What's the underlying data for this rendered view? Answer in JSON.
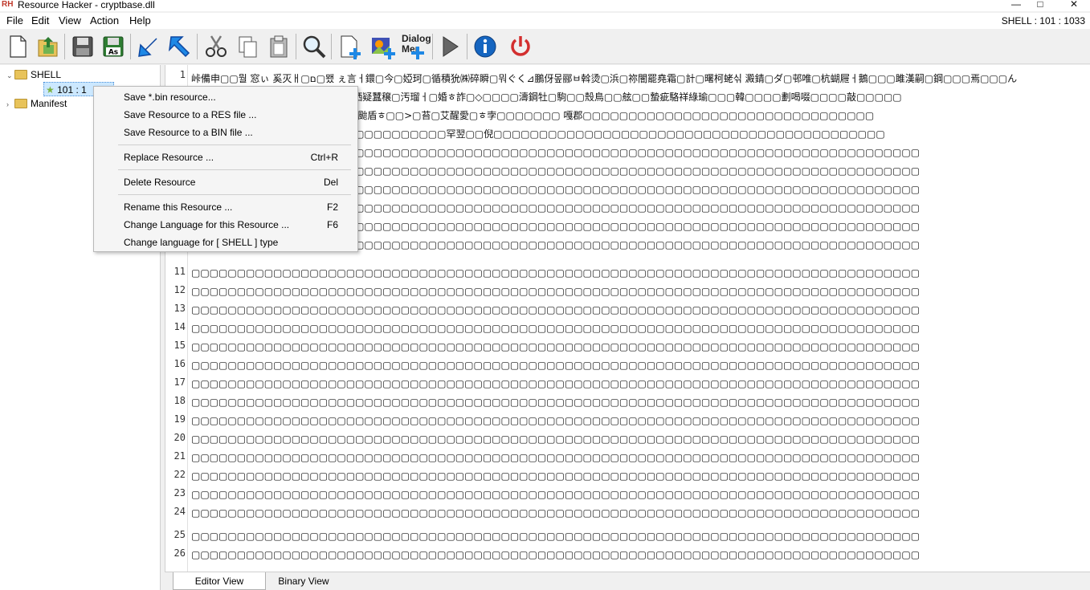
{
  "window": {
    "title": "Resource Hacker - cryptbase.dll",
    "logo_text": "RH",
    "minimize": "—",
    "maximize": "□",
    "close": "✕"
  },
  "status": {
    "resource_id": "SHELL : 101 : 1033"
  },
  "menu": [
    "File",
    "Edit",
    "View",
    "Action",
    "Help"
  ],
  "toolbar": {
    "dialog_label_1": "Dialog",
    "dialog_label_2": "Mer",
    "icons": [
      "new-file-icon",
      "open-icon",
      "save-icon",
      "save-as-icon",
      "arrow-back-icon",
      "arrow-forward-icon",
      "cut-icon",
      "copy-icon",
      "paste-icon",
      "find-icon",
      "add-resource-icon",
      "add-image-icon",
      "dialog-merger-icon",
      "play-icon",
      "info-icon",
      "power-icon"
    ],
    "save_as_badge": "As"
  },
  "tree": {
    "root": "SHELL",
    "child": "101 : 1",
    "manifest": "Manifest",
    "expander": "⌄",
    "collapser": "›"
  },
  "context_menu": [
    {
      "label": "Save *.bin resource...",
      "shortcut": ""
    },
    {
      "label": "Save Resource to a RES file ...",
      "shortcut": ""
    },
    {
      "label": "Save Resource to a BIN file ...",
      "shortcut": ""
    },
    {
      "label": "Replace Resource ...",
      "shortcut": "Ctrl+R"
    },
    {
      "label": "Delete Resource",
      "shortcut": "Del"
    },
    {
      "label": "Rename this Resource ...",
      "shortcut": "F2"
    },
    {
      "label": "Change Language for this Resource ...",
      "shortcut": "F6"
    },
    {
      "label": "Change language for [ SHELL ] type",
      "shortcut": ""
    }
  ],
  "editor": {
    "line_numbers": [
      "1",
      "2",
      "3",
      "4",
      "5",
      "6",
      "7",
      "8",
      "9",
      "10",
      "11",
      "12",
      "13",
      "14",
      "15",
      "16",
      "17",
      "18",
      "19",
      "20",
      "21",
      "22",
      "23",
      "24",
      "25",
      "26"
    ],
    "lines": [
      "峠備申▢▢뭘 窓ぃ 奚灭ㅐ▢ם▢뫴 ぇ言ㅓ鐶▢今▢婭珂▢循積狁㈱碎瞬▢뭐ぐく⊿鵬伢뫂郦ㅂ斡烫▢浜▢祢闇罷堯霜▢計▢曙柯蛯싞 澱錆▢ダ▢邨唯▢杭蝴屜ㅓ鵝▢▢▢雎漢嗣▢鋼▢▢▢焉▢▢▢ん",
      "▢▢▢▢鏨靴钳 ▢▢汽熡蝶愧▢▢▢▢洒疑蠶穣▢汚瑠ㅓ▢婚ㅎ詐▢◇▢▢▢▢濤鋼牡▢駒▢▢殼鳥▢▢舷▢▢蟄疵駱祥綠瑜▢▢▢韓▢▢▢▢劃喝啜▢▢▢▢敲▢▢▢▢▢",
      "▢▢▢▢▢▢▢▢▢▢▢▢鵬郎破萎柏▢颱盾ㅎ▢▢>▢苔▢艾醒愛▢ㅎ孛▢▢▢▢▢▢▢ 嘎郡▢▢▢▢▢▢▢▢▢▢▢▢▢▢▢▢▢▢▢▢▢▢▢▢▢▢▢▢▢▢▢▢",
      "▢▢▢▢▢▢▢▢▢▢▢▢▢▢▢▢▢▢▢▢▢▢▢▢▢▢▢▢罕翌▢▢倪▢▢▢▢▢▢▢▢▢▢▢▢▢▢▢▢▢▢▢▢▢▢▢▢▢▢▢▢▢▢▢▢▢▢▢▢▢▢▢▢▢▢▢",
      "▢▢▢▢▢▢▢▢▢▢▢▢▢▢▢▢▢▢▢▢▢▢▢▢▢▢▢▢▢▢▢▢▢▢▢▢▢▢▢▢▢▢▢▢▢▢▢▢▢▢▢▢▢▢▢▢▢▢▢▢▢▢▢▢▢▢▢▢▢▢▢▢▢▢▢▢▢▢▢▢",
      "▢▢▢▢▢▢▢▢▢▢▢▢▢▢▢▢▢▢▢▢▢▢▢▢▢▢▢▢▢▢▢▢▢▢▢▢▢▢▢▢▢▢▢▢▢▢▢▢▢▢▢▢▢▢▢▢▢▢▢▢▢▢▢▢▢▢▢▢▢▢▢▢▢▢▢▢▢▢▢▢",
      "▢▢▢▢▢▢▢▢▢▢▢▢▢▢▢▢▢▢▢▢▢▢▢▢▢▢▢▢▢▢▢▢▢▢▢▢▢▢▢▢▢▢▢▢▢▢▢▢▢▢▢▢▢▢▢▢▢▢▢▢▢▢▢▢▢▢▢▢▢▢▢▢▢▢▢▢▢▢▢▢",
      "▢▢▢▢▢▢▢▢▢▢▢▢▢▢▢▢▢▢▢▢▢▢▢▢▢▢▢▢▢▢▢▢▢▢▢▢▢▢▢▢▢▢▢▢▢▢▢▢▢▢▢▢▢▢▢▢▢▢▢▢▢▢▢▢▢▢▢▢▢▢▢▢▢▢▢▢▢▢▢▢",
      "▢▢▢▢▢▢▢▢▢▢▢▢▢▢▢▢▢▢▢▢▢▢▢▢▢▢▢▢▢▢▢▢▢▢▢▢▢▢▢▢▢▢▢▢▢▢▢▢▢▢▢▢▢▢▢▢▢▢▢▢▢▢▢▢▢▢▢▢▢▢▢▢▢▢▢▢▢▢▢▢",
      "▢▢▢▢▢▢▢▢▢▢▢▢▢▢▢▢▢▢▢▢▢▢▢▢▢▢▢▢▢▢▢▢▢▢▢▢▢▢▢▢▢▢▢▢▢▢▢▢▢▢▢▢▢▢▢▢▢▢▢▢▢▢▢▢▢▢▢▢▢▢▢▢▢▢▢▢▢▢▢▢",
      "▢▢▢▢▢▢▢▢▢▢▢▢▢▢▢▢▢▢▢▢▢▢▢▢▢▢▢▢▢▢▢▢▢▢▢▢▢▢▢▢▢▢▢▢▢▢▢▢▢▢▢▢▢▢▢▢▢▢▢▢▢▢▢▢▢▢▢▢▢▢▢▢▢▢▢▢▢▢▢▢",
      "▢▢▢▢▢▢▢▢▢▢▢▢▢▢▢▢▢▢▢▢▢▢▢▢▢▢▢▢▢▢▢▢▢▢▢▢▢▢▢▢▢▢▢▢▢▢▢▢▢▢▢▢▢▢▢▢▢▢▢▢▢▢▢▢▢▢▢▢▢▢▢▢▢▢▢▢▢▢▢▢",
      "▢▢▢▢▢▢▢▢▢▢▢▢▢▢▢▢▢▢▢▢▢▢▢▢▢▢▢▢▢▢▢▢▢▢▢▢▢▢▢▢▢▢▢▢▢▢▢▢▢▢▢▢▢▢▢▢▢▢▢▢▢▢▢▢▢▢▢▢▢▢▢▢▢▢▢▢▢▢▢▢",
      "▢▢▢▢▢▢▢▢▢▢▢▢▢▢▢▢▢▢▢▢▢▢▢▢▢▢▢▢▢▢▢▢▢▢▢▢▢▢▢▢▢▢▢▢▢▢▢▢▢▢▢▢▢▢▢▢▢▢▢▢▢▢▢▢▢▢▢▢▢▢▢▢▢▢▢▢▢▢▢▢",
      "▢▢▢▢▢▢▢▢▢▢▢▢▢▢▢▢▢▢▢▢▢▢▢▢▢▢▢▢▢▢▢▢▢▢▢▢▢▢▢▢▢▢▢▢▢▢▢▢▢▢▢▢▢▢▢▢▢▢▢▢▢▢▢▢▢▢▢▢▢▢▢▢▢▢▢▢▢▢▢▢",
      "▢▢▢▢▢▢▢▢▢▢▢▢▢▢▢▢▢▢▢▢▢▢▢▢▢▢▢▢▢▢▢▢▢▢▢▢▢▢▢▢▢▢▢▢▢▢▢▢▢▢▢▢▢▢▢▢▢▢▢▢▢▢▢▢▢▢▢▢▢▢▢▢▢▢▢▢▢▢▢▢",
      "▢▢▢▢▢▢▢▢▢▢▢▢▢▢▢▢▢▢▢▢▢▢▢▢▢▢▢▢▢▢▢▢▢▢▢▢▢▢▢▢▢▢▢▢▢▢▢▢▢▢▢▢▢▢▢▢▢▢▢▢▢▢▢▢▢▢▢▢▢▢▢▢▢▢▢▢▢▢▢▢",
      "▢▢▢▢▢▢▢▢▢▢▢▢▢▢▢▢▢▢▢▢▢▢▢▢▢▢▢▢▢▢▢▢▢▢▢▢▢▢▢▢▢▢▢▢▢▢▢▢▢▢▢▢▢▢▢▢▢▢▢▢▢▢▢▢▢▢▢▢▢▢▢▢▢▢▢▢▢▢▢▢",
      "▢▢▢▢▢▢▢▢▢▢▢▢▢▢▢▢▢▢▢▢▢▢▢▢▢▢▢▢▢▢▢▢▢▢▢▢▢▢▢▢▢▢▢▢▢▢▢▢▢▢▢▢▢▢▢▢▢▢▢▢▢▢▢▢▢▢▢▢▢▢▢▢▢▢▢▢▢▢▢▢",
      "▢▢▢▢▢▢▢▢▢▢▢▢▢▢▢▢▢▢▢▢▢▢▢▢▢▢▢▢▢▢▢▢▢▢▢▢▢▢▢▢▢▢▢▢▢▢▢▢▢▢▢▢▢▢▢▢▢▢▢▢▢▢▢▢▢▢▢▢▢▢▢▢▢▢▢▢▢▢▢▢",
      "▢▢▢▢▢▢▢▢▢▢▢▢▢▢▢▢▢▢▢▢▢▢▢▢▢▢▢▢▢▢▢▢▢▢▢▢▢▢▢▢▢▢▢▢▢▢▢▢▢▢▢▢▢▢▢▢▢▢▢▢▢▢▢▢▢▢▢▢▢▢▢▢▢▢▢▢▢▢▢▢",
      "▢▢▢▢▢▢▢▢▢▢▢▢▢▢▢▢▢▢▢▢▢▢▢▢▢▢▢▢▢▢▢▢▢▢▢▢▢▢▢▢▢▢▢▢▢▢▢▢▢▢▢▢▢▢▢▢▢▢▢▢▢▢▢▢▢▢▢▢▢▢▢▢▢▢▢▢▢▢▢▢",
      "▢▢▢▢▢▢▢▢▢▢▢▢▢▢▢▢▢▢▢▢▢▢▢▢▢▢▢▢▢▢▢▢▢▢▢▢▢▢▢▢▢▢▢▢▢▢▢▢▢▢▢▢▢▢▢▢▢▢▢▢▢▢▢▢▢▢▢▢▢▢▢▢▢▢▢▢▢▢▢▢",
      "▢▢▢▢▢▢▢▢▢▢▢▢▢▢▢▢▢▢▢▢▢▢▢▢▢▢▢▢▢▢▢▢▢▢▢▢▢▢▢▢▢▢▢▢▢▢▢▢▢▢▢▢▢▢▢▢▢▢▢▢▢▢▢▢▢▢▢▢▢▢▢▢▢▢▢▢▢▢▢▢",
      "▢▢▢▢▢▢▢▢▢▢▢▢▢▢▢▢▢▢▢▢▢▢▢▢▢▢▢▢▢▢▢▢▢▢▢▢▢▢▢▢▢▢▢▢▢▢▢▢▢▢▢▢▢▢▢▢▢▢▢▢▢▢▢▢▢▢▢▢▢▢▢▢▢▢▢▢▢▢▢▢",
      "▢▢▢▢▢▢▢▢▢▢▢▢▢▢▢▢▢▢▢▢▢▢▢▢▢▢▢▢▢▢▢▢▢▢▢▢▢▢▢▢▢▢▢▢▢▢▢▢▢▢▢▢▢▢▢▢▢▢▢▢▢▢▢▢▢▢▢▢▢▢▢▢▢▢▢▢▢▢▢▢"
    ]
  },
  "tabs": [
    "Editor View",
    "Binary View"
  ],
  "colors": {
    "window_bg": "#f0f0f0",
    "selection": "#cce8ff",
    "folder": "#e8c35a",
    "accent_blue": "#1e88e5",
    "power_red": "#d32f2f"
  }
}
